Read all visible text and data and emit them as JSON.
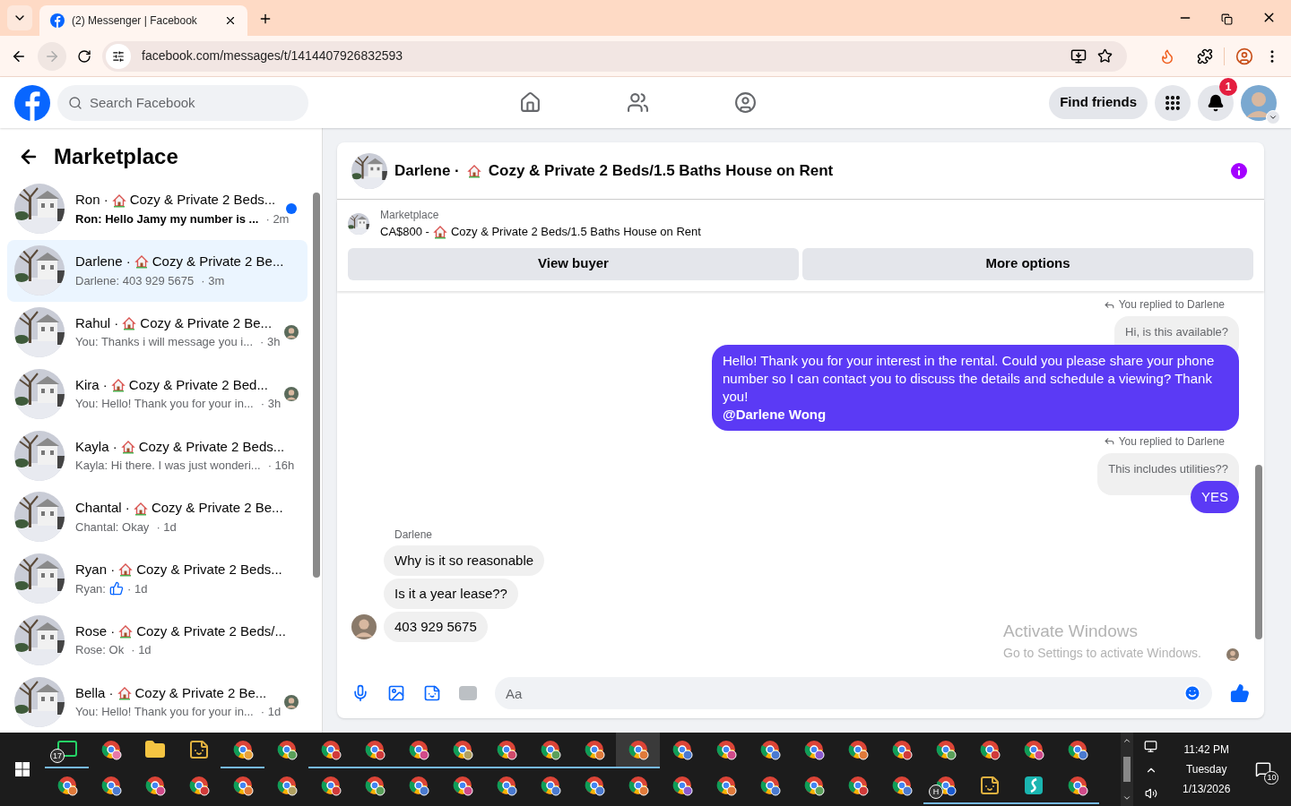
{
  "browser": {
    "tab_title": "(2) Messenger | Facebook",
    "url": "facebook.com/messages/t/1414407926832593"
  },
  "header": {
    "search_placeholder": "Search Facebook",
    "find_friends": "Find friends",
    "notification_count": "1"
  },
  "sidebar": {
    "title": "Marketplace",
    "conversations": [
      {
        "name": "Ron ·",
        "listing": "Cozy & Private 2 Beds...",
        "preview": "Ron: Hello Jamy my number is ...",
        "time": "· 2m",
        "unread": true,
        "selected": false,
        "seen_avatar": false
      },
      {
        "name": "Darlene ·",
        "listing": "Cozy & Private 2 Be...",
        "preview": "Darlene: 403 929 5675",
        "time": "· 3m",
        "unread": false,
        "selected": true,
        "seen_avatar": false
      },
      {
        "name": "Rahul ·",
        "listing": "Cozy & Private 2 Be...",
        "preview": "You: Thanks i will message you i...",
        "time": "· 3h",
        "unread": false,
        "selected": false,
        "seen_avatar": true
      },
      {
        "name": "Kira ·",
        "listing": "Cozy & Private 2 Bed...",
        "preview": "You: Hello! Thank you for your in...",
        "time": "· 3h",
        "unread": false,
        "selected": false,
        "seen_avatar": true
      },
      {
        "name": "Kayla ·",
        "listing": "Cozy & Private 2 Beds...",
        "preview": "Kayla: Hi there. I was just wonderi...",
        "time": "· 16h",
        "unread": false,
        "selected": false,
        "seen_avatar": false
      },
      {
        "name": "Chantal ·",
        "listing": "Cozy & Private 2 Be...",
        "preview": "Chantal: Okay",
        "time": "· 1d",
        "unread": false,
        "selected": false,
        "seen_avatar": false
      },
      {
        "name": "Ryan ·",
        "listing": "Cozy & Private 2 Beds...",
        "preview": "Ryan:",
        "time": "· 1d",
        "unread": false,
        "selected": false,
        "seen_avatar": false,
        "like": true
      },
      {
        "name": "Rose ·",
        "listing": "Cozy & Private 2 Beds/...",
        "preview": "Rose: Ok",
        "time": "· 1d",
        "unread": false,
        "selected": false,
        "seen_avatar": false
      },
      {
        "name": "Bella ·",
        "listing": "Cozy & Private 2 Be...",
        "preview": "You: Hello! Thank you for your in...",
        "time": "· 1d",
        "unread": false,
        "selected": false,
        "seen_avatar": true
      }
    ]
  },
  "chat": {
    "name": "Darlene ·",
    "listing": "Cozy & Private 2 Beds/1.5 Baths House on Rent",
    "listing_card": {
      "label": "Marketplace",
      "price": "CA$800 -",
      "title": "Cozy & Private 2 Beds/1.5 Baths House on Rent",
      "buttons": [
        "View buyer",
        "More options"
      ]
    },
    "messages": [
      {
        "kind": "reply",
        "note": "You replied to Darlene",
        "quote": "Hi, is this available?",
        "text": "Hello! Thank you for your interest in the rental. Could you please share your phone number so I can contact you to discuss the details and schedule a viewing? Thank you!",
        "mention": "@Darlene Wong"
      },
      {
        "kind": "reply",
        "note": "You replied to Darlene",
        "quote": "This includes utilities??",
        "text": "YES"
      },
      {
        "kind": "sender",
        "text": "Darlene"
      },
      {
        "kind": "incoming",
        "text": "Why is it so reasonable",
        "avatar": false
      },
      {
        "kind": "incoming",
        "text": "Is it a year lease??",
        "avatar": false
      },
      {
        "kind": "incoming",
        "text": "403 929 5675",
        "avatar": true
      }
    ],
    "composer_placeholder": "Aa"
  },
  "watermark": {
    "title": "Activate Windows",
    "subtitle": "Go to Settings to activate Windows."
  },
  "taskbar": {
    "rows": [
      [
        {
          "kind": "whatsapp",
          "open": true,
          "badge": "17"
        },
        {
          "kind": "chrome",
          "open": false,
          "color": "#e879a8"
        },
        {
          "kind": "folder",
          "open": false
        },
        {
          "kind": "app",
          "open": false
        },
        {
          "kind": "chrome",
          "open": true,
          "color": "#e8a23a"
        },
        {
          "kind": "chrome",
          "open": false,
          "color": "#5aa05a"
        },
        {
          "kind": "chrome",
          "open": true,
          "color": "#d03a3a"
        },
        {
          "kind": "chrome",
          "open": true,
          "color": "#d03a3a"
        },
        {
          "kind": "chrome",
          "open": true,
          "color": "#d04a8a"
        },
        {
          "kind": "chrome",
          "open": true,
          "color": "#b0a060"
        },
        {
          "kind": "chrome",
          "open": true,
          "color": "#d04a6a"
        },
        {
          "kind": "chrome",
          "open": true,
          "color": "#5aa05a"
        },
        {
          "kind": "chrome",
          "open": true,
          "color": "#e07a3a"
        },
        {
          "kind": "chrome",
          "open": true,
          "color": "#e07a3a",
          "active": true
        },
        {
          "kind": "chrome",
          "open": false,
          "color": "#4a7ad0"
        },
        {
          "kind": "chrome",
          "open": false,
          "color": "#d04a8a"
        },
        {
          "kind": "chrome",
          "open": false,
          "color": "#4a7ad0"
        },
        {
          "kind": "chrome",
          "open": false,
          "color": "#8a5ad0"
        },
        {
          "kind": "chrome",
          "open": false,
          "color": "#e07a3a"
        },
        {
          "kind": "chrome",
          "open": false,
          "color": "#d03a3a"
        },
        {
          "kind": "chrome",
          "open": false,
          "color": "#5aa05a"
        },
        {
          "kind": "chrome",
          "open": false,
          "color": "#d03a3a"
        },
        {
          "kind": "chrome",
          "open": false,
          "color": "#d04a8a"
        },
        {
          "kind": "chrome",
          "open": false,
          "color": "#4a7ad0"
        }
      ],
      [
        {
          "kind": "chrome",
          "open": false,
          "color": "#e07a3a"
        },
        {
          "kind": "chrome",
          "open": false,
          "color": "#4a7ad0"
        },
        {
          "kind": "chrome",
          "open": false,
          "color": "#d04a8a"
        },
        {
          "kind": "chrome",
          "open": false,
          "color": "#d03a3a"
        },
        {
          "kind": "chrome",
          "open": false,
          "color": "#e07a3a"
        },
        {
          "kind": "chrome",
          "open": false,
          "color": "#b0a060"
        },
        {
          "kind": "chrome",
          "open": false,
          "color": "#d03a3a"
        },
        {
          "kind": "chrome",
          "open": false,
          "color": "#5aa05a"
        },
        {
          "kind": "chrome",
          "open": false,
          "color": "#4a7ad0"
        },
        {
          "kind": "chrome",
          "open": false,
          "color": "#d04a8a"
        },
        {
          "kind": "chrome",
          "open": false,
          "color": "#4a7ad0"
        },
        {
          "kind": "chrome",
          "open": false,
          "color": "#4a7ad0"
        },
        {
          "kind": "chrome",
          "open": false,
          "color": "#4a7ad0"
        },
        {
          "kind": "chrome",
          "open": false,
          "color": "#e07a3a"
        },
        {
          "kind": "chrome",
          "open": false,
          "color": "#8a5ad0"
        },
        {
          "kind": "chrome",
          "open": false,
          "color": "#e07a3a"
        },
        {
          "kind": "chrome",
          "open": false,
          "color": "#4a7ad0"
        },
        {
          "kind": "chrome",
          "open": false,
          "color": "#5aa05a"
        },
        {
          "kind": "chrome",
          "open": false,
          "color": "#d03a3a"
        },
        {
          "kind": "chrome",
          "open": false,
          "color": "#4a7ad0"
        },
        {
          "kind": "chrome",
          "open": true,
          "color": "#1a5ad0",
          "badge": "H"
        },
        {
          "kind": "app",
          "open": true
        },
        {
          "kind": "surfshark",
          "open": true
        },
        {
          "kind": "chrome",
          "open": true,
          "color": "#d04a8a"
        }
      ]
    ],
    "time": "11:42 PM",
    "day": "Tuesday",
    "date": "1/13/2026",
    "notifications": "10"
  }
}
